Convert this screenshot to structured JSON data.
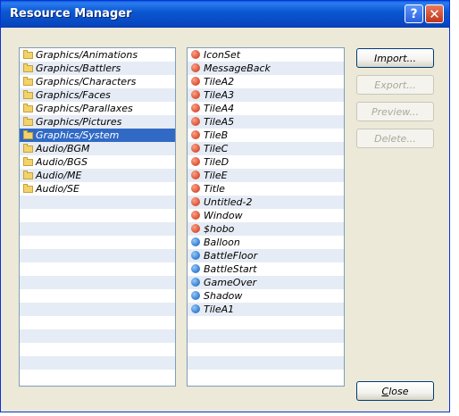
{
  "window": {
    "title": "Resource Manager",
    "help_symbol": "?",
    "close_symbol": "✕"
  },
  "folders": [
    {
      "label": "Graphics/Animations",
      "selected": false
    },
    {
      "label": "Graphics/Battlers",
      "selected": false
    },
    {
      "label": "Graphics/Characters",
      "selected": false
    },
    {
      "label": "Graphics/Faces",
      "selected": false
    },
    {
      "label": "Graphics/Parallaxes",
      "selected": false
    },
    {
      "label": "Graphics/Pictures",
      "selected": false
    },
    {
      "label": "Graphics/System",
      "selected": true
    },
    {
      "label": "Audio/BGM",
      "selected": false
    },
    {
      "label": "Audio/BGS",
      "selected": false
    },
    {
      "label": "Audio/ME",
      "selected": false
    },
    {
      "label": "Audio/SE",
      "selected": false
    }
  ],
  "resources": [
    {
      "label": "IconSet",
      "color": "red"
    },
    {
      "label": "MessageBack",
      "color": "red"
    },
    {
      "label": "TileA2",
      "color": "red"
    },
    {
      "label": "TileA3",
      "color": "red"
    },
    {
      "label": "TileA4",
      "color": "red"
    },
    {
      "label": "TileA5",
      "color": "red"
    },
    {
      "label": "TileB",
      "color": "red"
    },
    {
      "label": "TileC",
      "color": "red"
    },
    {
      "label": "TileD",
      "color": "red"
    },
    {
      "label": "TileE",
      "color": "red"
    },
    {
      "label": "Title",
      "color": "red"
    },
    {
      "label": "Untitled-2",
      "color": "red"
    },
    {
      "label": "Window",
      "color": "red"
    },
    {
      "label": "$hobo",
      "color": "red"
    },
    {
      "label": "Balloon",
      "color": "blue"
    },
    {
      "label": "BattleFloor",
      "color": "blue"
    },
    {
      "label": "BattleStart",
      "color": "blue"
    },
    {
      "label": "GameOver",
      "color": "blue"
    },
    {
      "label": "Shadow",
      "color": "blue"
    },
    {
      "label": "TileA1",
      "color": "blue"
    }
  ],
  "buttons": {
    "import": {
      "label": "Import...",
      "enabled": true
    },
    "export": {
      "label": "Export...",
      "enabled": false
    },
    "preview": {
      "label": "Preview...",
      "enabled": false
    },
    "delete": {
      "label": "Delete...",
      "enabled": false
    },
    "close_mnemonic": "C",
    "close_rest": "lose"
  },
  "colors": {
    "selection": "#316ac5",
    "alt_row": "#e6ecf5",
    "red_dot": "#e05a3a",
    "blue_dot": "#3c86d8"
  }
}
